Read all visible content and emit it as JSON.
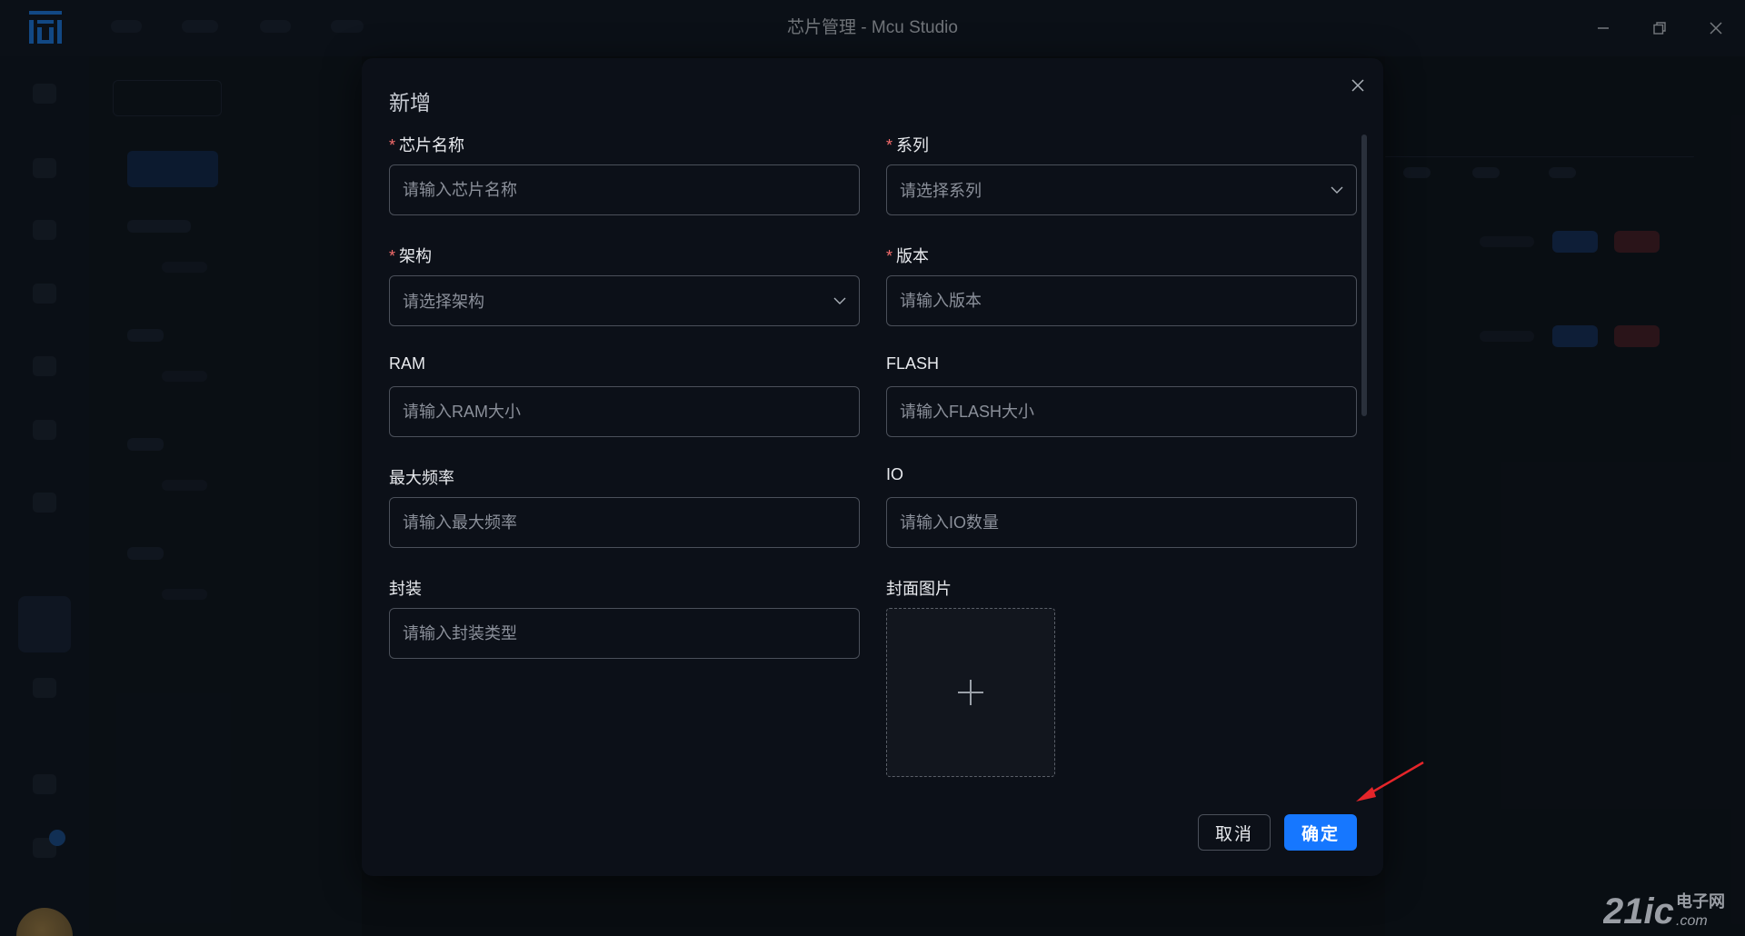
{
  "window": {
    "title": "芯片管理 - Mcu Studio",
    "controls": [
      "minimize-icon",
      "restore-icon",
      "close-icon"
    ]
  },
  "dialog": {
    "title": "新增",
    "fields": {
      "chip_name": {
        "label": "芯片名称",
        "required": true,
        "placeholder": "请输入芯片名称"
      },
      "series": {
        "label": "系列",
        "required": true,
        "placeholder": "请选择系列"
      },
      "arch": {
        "label": "架构",
        "required": true,
        "placeholder": "请选择架构"
      },
      "version": {
        "label": "版本",
        "required": true,
        "placeholder": "请输入版本"
      },
      "ram": {
        "label": "RAM",
        "placeholder": "请输入RAM大小"
      },
      "flash": {
        "label": "FLASH",
        "placeholder": "请输入FLASH大小"
      },
      "max_freq": {
        "label": "最大频率",
        "placeholder": "请输入最大频率"
      },
      "io": {
        "label": "IO",
        "placeholder": "请输入IO数量"
      },
      "package": {
        "label": "封装",
        "placeholder": "请输入封装类型"
      },
      "cover": {
        "label": "封面图片"
      }
    },
    "required_mark": "*",
    "buttons": {
      "cancel": "取消",
      "confirm": "确定"
    }
  },
  "colors": {
    "primary": "#1677ff",
    "required": "#f56c6c",
    "dialog_bg": "#0c1018",
    "annotation_arrow": "#e5252a"
  }
}
